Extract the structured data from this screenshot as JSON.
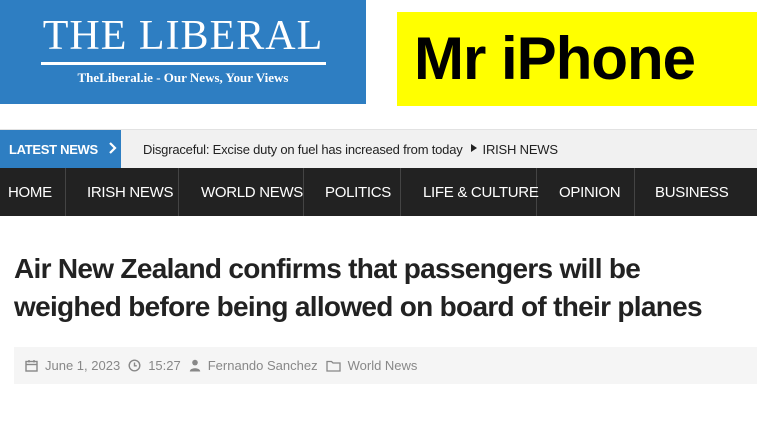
{
  "site": {
    "logo_title": "THE LIBERAL",
    "logo_tagline": "TheLiberal.ie - Our News, Your Views"
  },
  "ad": {
    "text": "Mr iPhone"
  },
  "ticker": {
    "label": "LATEST NEWS",
    "headline": "Disgraceful: Excise duty on fuel has increased from today",
    "category": "IRISH NEWS"
  },
  "nav": {
    "items": [
      "HOME",
      "IRISH NEWS",
      "WORLD NEWS",
      "POLITICS",
      "LIFE & CULTURE",
      "OPINION",
      "BUSINESS"
    ]
  },
  "article": {
    "title": "Air New Zealand confirms that passengers will be weighed before being allowed on board of their planes",
    "date": "June 1, 2023",
    "time": "15:27",
    "author": "Fernando Sanchez",
    "category": "World News"
  },
  "colors": {
    "brand_blue": "#2e7ec2",
    "ad_yellow": "#ffff00",
    "nav_dark": "#222222",
    "meta_grey": "#888888"
  }
}
